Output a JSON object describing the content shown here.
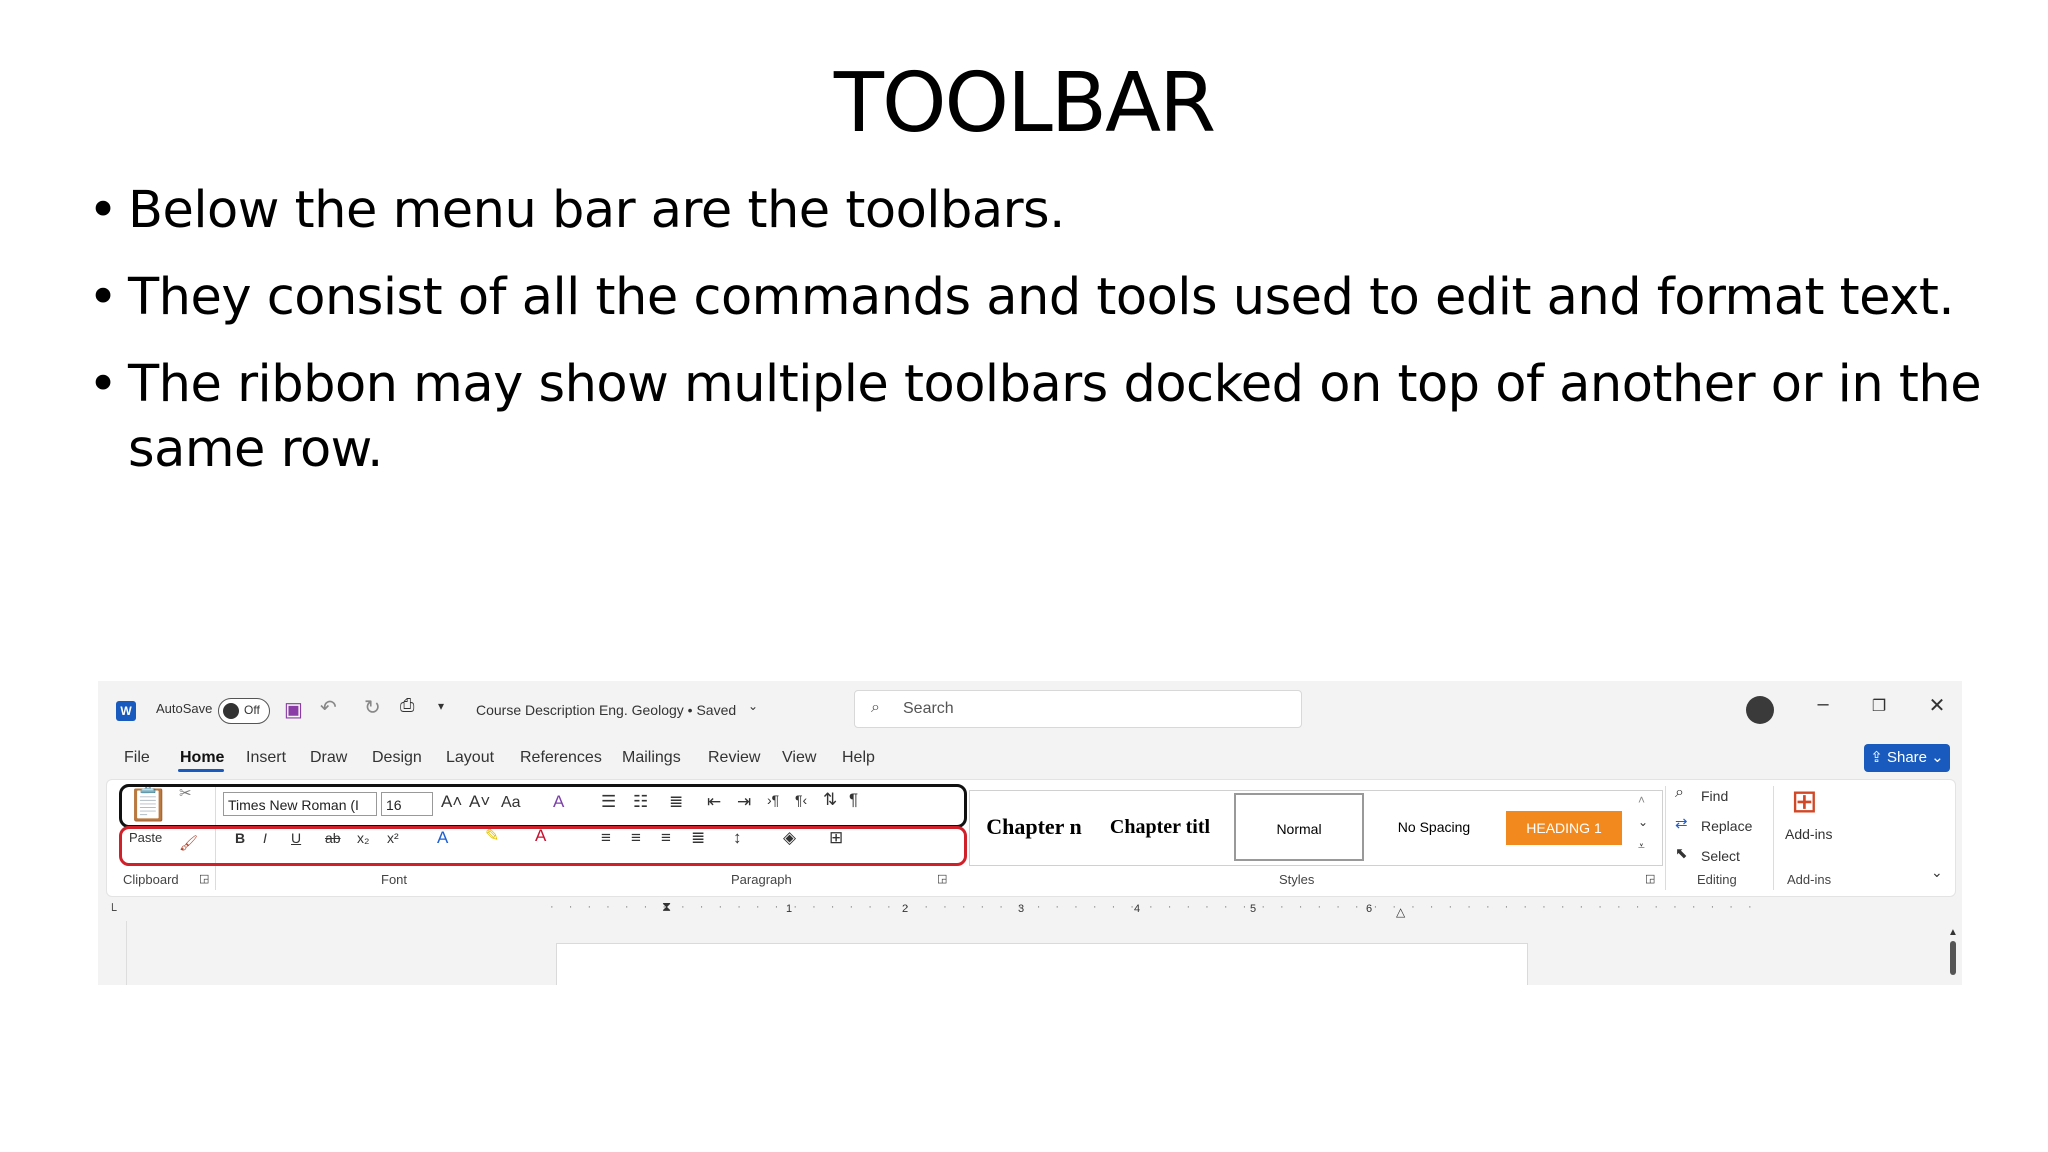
{
  "slide": {
    "title": "TOOLBAR",
    "bullets": [
      "Below the menu bar are the toolbars.",
      "They consist of all the commands and tools used to edit and format text.",
      "The ribbon may show multiple toolbars docked on top of another or in the same row."
    ],
    "bullet_char": "•"
  },
  "word": {
    "autosave_label": "AutoSave",
    "autosave_state": "Off",
    "doc_title": "Course Description Eng. Geology • Saved",
    "search_placeholder": "Search",
    "menu": [
      "File",
      "Home",
      "Insert",
      "Draw",
      "Design",
      "Layout",
      "References",
      "Mailings",
      "Review",
      "View",
      "Help"
    ],
    "active_menu": "Home",
    "share_label": "Share",
    "font_name": "Times New Roman (I",
    "font_size": "16",
    "paste_label": "Paste",
    "groups": {
      "clipboard": "Clipboard",
      "font": "Font",
      "paragraph": "Paragraph",
      "styles": "Styles",
      "editing": "Editing",
      "addins": "Add-ins"
    },
    "styles": [
      "Chapter n",
      "Chapter titl",
      "Normal",
      "No Spacing",
      "HEADING 1"
    ],
    "editing": [
      "Find",
      "Replace",
      "Select"
    ],
    "addins_label": "Add-ins",
    "ruler_numbers": [
      "1",
      "2",
      "3",
      "4",
      "5",
      "6"
    ],
    "font_buttons": [
      "B",
      "I",
      "U",
      "ab",
      "x₂",
      "x²"
    ],
    "case_button": "Aa",
    "colors": {
      "accent": "#185abd",
      "heading1_bg": "#f2891e",
      "highlight_box_top": "#111111",
      "highlight_box_bottom": "#d0202a"
    }
  }
}
